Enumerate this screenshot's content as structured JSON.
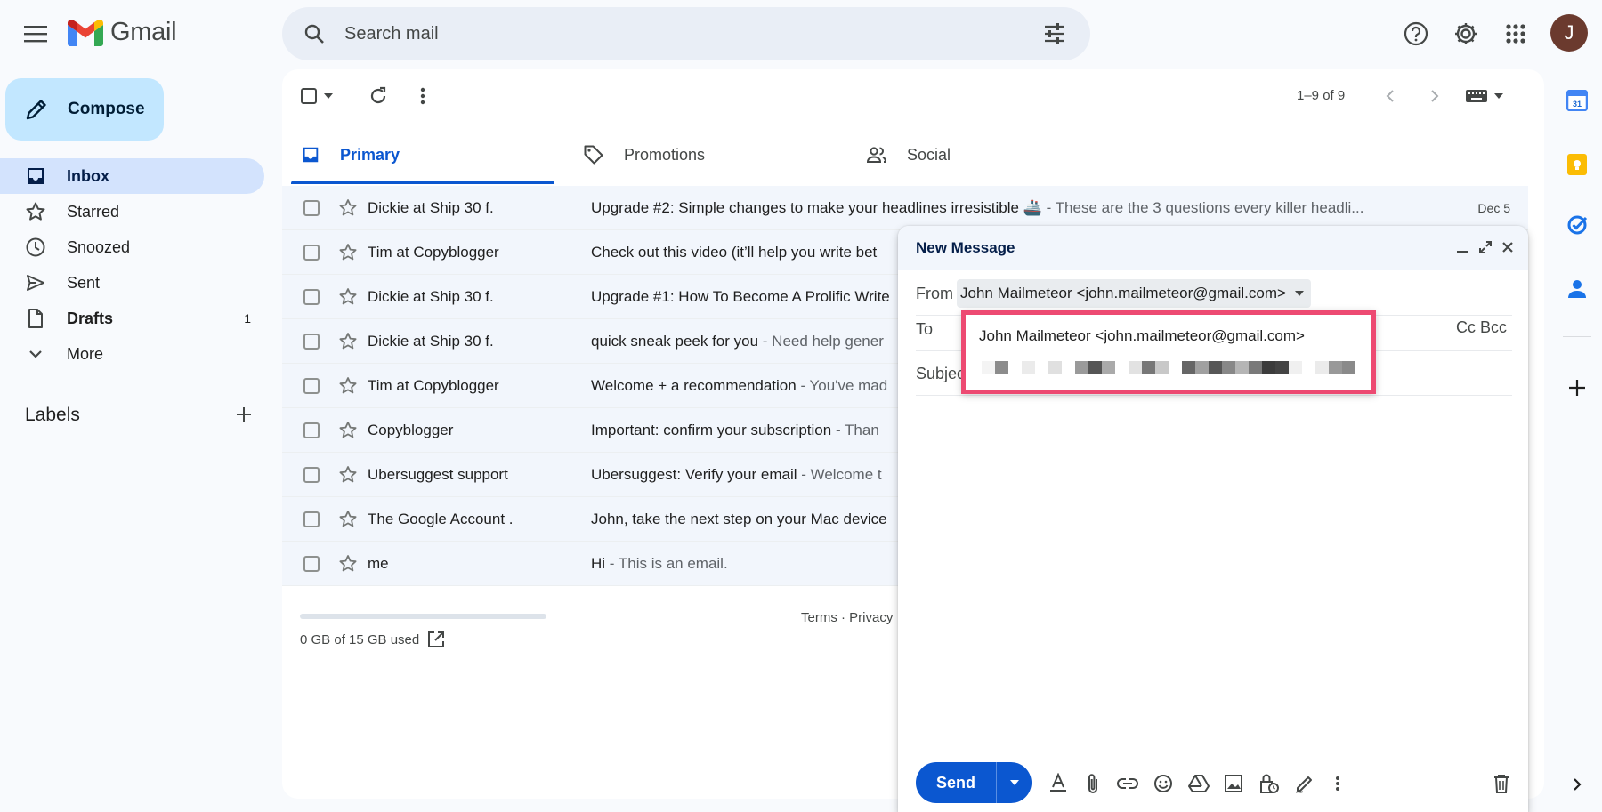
{
  "app": {
    "name": "Gmail"
  },
  "search": {
    "placeholder": "Search mail"
  },
  "user": {
    "avatar_initial": "J"
  },
  "compose_button": {
    "label": "Compose"
  },
  "nav": [
    {
      "label": "Inbox",
      "icon": "inbox-icon",
      "count": ""
    },
    {
      "label": "Starred",
      "icon": "star-icon",
      "count": ""
    },
    {
      "label": "Snoozed",
      "icon": "clock-icon",
      "count": ""
    },
    {
      "label": "Sent",
      "icon": "send-icon",
      "count": ""
    },
    {
      "label": "Drafts",
      "icon": "draft-icon",
      "count": "1"
    },
    {
      "label": "More",
      "icon": "chevron-down-icon",
      "count": ""
    }
  ],
  "labels": {
    "title": "Labels"
  },
  "toolbar": {
    "pagination": "1–9 of 9"
  },
  "tabs": [
    {
      "label": "Primary",
      "icon": "inbox-icon",
      "active": true
    },
    {
      "label": "Promotions",
      "icon": "tag-icon",
      "active": false
    },
    {
      "label": "Social",
      "icon": "people-icon",
      "active": false
    }
  ],
  "emails": [
    {
      "sender": "Dickie at Ship 30 f.",
      "subject": "Upgrade #2: Simple changes to make your headlines irresistible 🚢",
      "snippet": " - These are the 3 questions every killer headli...",
      "date": "Dec 5"
    },
    {
      "sender": "Tim at Copyblogger",
      "subject": "Check out this video (it’ll help you write bet",
      "snippet": "",
      "date": ""
    },
    {
      "sender": "Dickie at Ship 30 f.",
      "subject": "Upgrade #1: How To Become A Prolific Write",
      "snippet": "",
      "date": ""
    },
    {
      "sender": "Dickie at Ship 30 f.",
      "subject": "quick sneak peek for you",
      "snippet": " - Need help gener",
      "date": ""
    },
    {
      "sender": "Tim at Copyblogger",
      "subject": "Welcome + a recommendation",
      "snippet": " - You've mad",
      "date": ""
    },
    {
      "sender": "Copyblogger",
      "subject": "Important: confirm your subscription",
      "snippet": " - Than",
      "date": ""
    },
    {
      "sender": "Ubersuggest support",
      "subject": "Ubersuggest: Verify your email",
      "snippet": " - Welcome t",
      "date": ""
    },
    {
      "sender": "The Google Account .",
      "subject": "John, take the next step on your Mac device",
      "snippet": "",
      "date": ""
    },
    {
      "sender": "me",
      "subject": "Hi",
      "snippet": " - This is an email.",
      "date": ""
    }
  ],
  "storage": {
    "text": "0 GB of 15 GB used"
  },
  "footer": {
    "links": "Terms · Privacy"
  },
  "compose_window": {
    "title": "New Message",
    "from_label": "From",
    "from_value": "John Mailmeteor <john.mailmeteor@gmail.com>",
    "to_label": "To",
    "cc_bcc": "Cc Bcc",
    "subject_label": "Subject",
    "send_label": "Send"
  },
  "autocomplete": {
    "suggestion": "John Mailmeteor <john.mailmeteor@gmail.com>"
  },
  "colors": {
    "accent": "#0b57d0",
    "compose_bg": "#c2e7ff",
    "active_nav_bg": "#d3e3fd",
    "highlight_border": "#ed4a72"
  }
}
